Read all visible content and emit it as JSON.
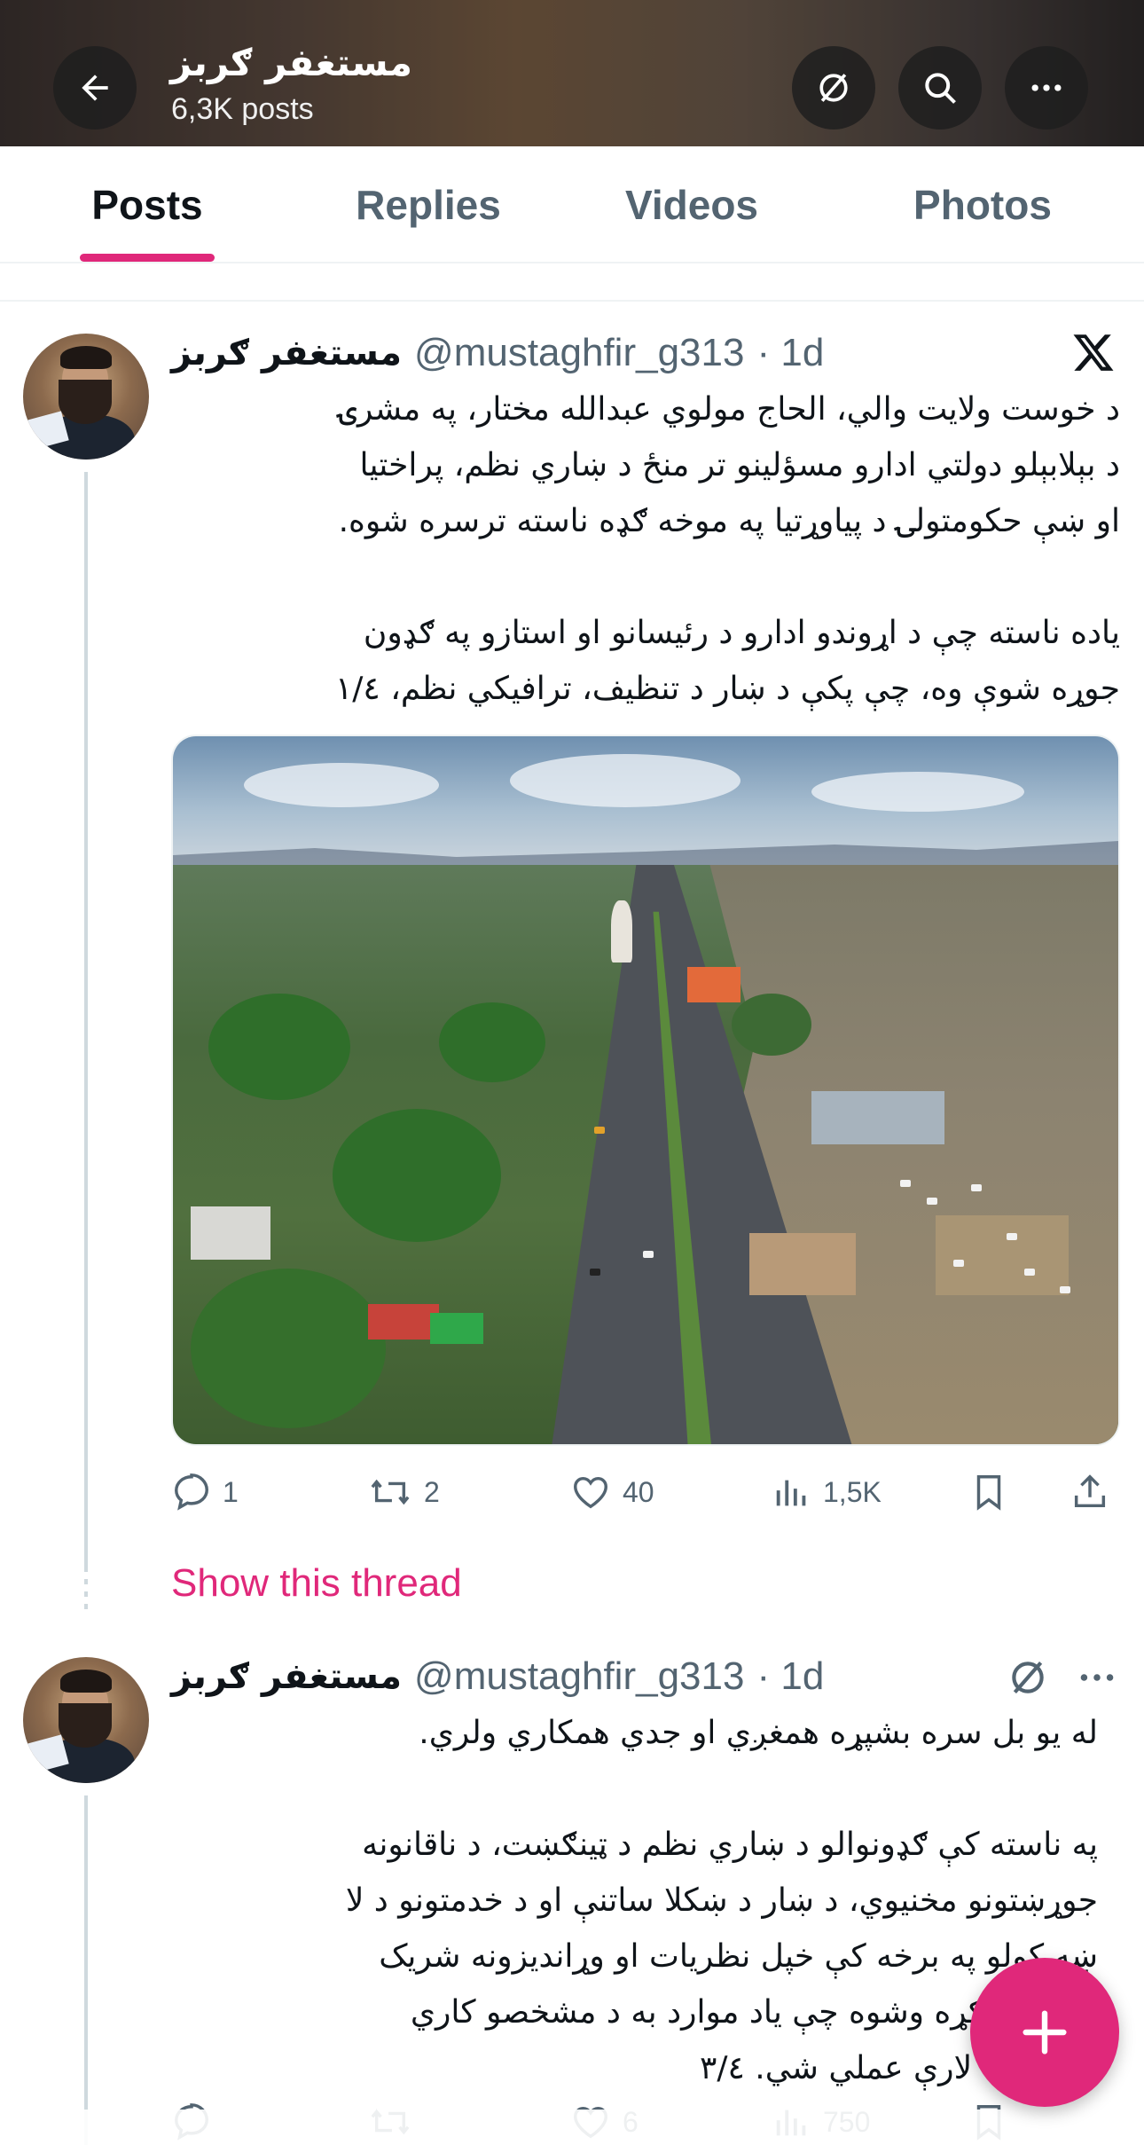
{
  "header": {
    "title": "مستغفر ګربز",
    "posts_count": "6,3K posts"
  },
  "tabs": [
    {
      "label": "Posts",
      "active": true
    },
    {
      "label": "Replies",
      "active": false
    },
    {
      "label": "Videos",
      "active": false
    },
    {
      "label": "Photos",
      "active": false
    }
  ],
  "tweets": [
    {
      "name": "مستغفر ګربز",
      "handle": "@mustaghfir_g313",
      "time": "· 1d",
      "text": "د خوست ولایت والي، الحاج مولوي عبدالله مختار، په مشرۍ\nد بېلابېلو دولتي ادارو مسؤلینو تر منځ د ښاري نظم، پراختیا\nاو ښې حکومتولۍ د پیاوړتیا په موخه ګډه ناسته ترسره شوه.\n\nیاده ناسته چې د اړوندو ادارو د رئیسانو او استازو په ګډون\nجوړه شوې وه، چې پکې د ښار د تنظیف، ترافیکي نظم، ۱/٤",
      "actions": {
        "replies": "1",
        "reposts": "2",
        "likes": "40",
        "views": "1,5K"
      }
    },
    {
      "name": "مستغفر ګربز",
      "handle": "@mustaghfir_g313",
      "time": "· 1d",
      "text": "له یو بل سره بشپړه همغږي او جدي همکاري ولري.\n\nپه ناسته کې ګډونوالو د ښاري نظم د ټینګښت، د ناقانونه\nجوړښتونو مخنیوي، د ښار د ښکلا ساتنې او د خدمتونو د لا\nښه کولو په برخه کې خپل نظریات او وړاندیزونه شریک\nکړل. پرېکړه وشوه چې یاد موارد به د مشخصو کاري\nپلانونو له لارې عملي شي. ۳/٤",
      "actions": {
        "replies": "",
        "reposts": "",
        "likes": "6",
        "views": "750"
      }
    }
  ],
  "show_thread": "Show this thread",
  "colors": {
    "accent": "#e0287a",
    "muted": "#536471",
    "text": "#0f1419"
  },
  "icons": [
    "back-arrow-icon",
    "hide-icon",
    "search-icon",
    "more-icon",
    "x-logo-icon",
    "reply-icon",
    "repost-icon",
    "like-icon",
    "views-icon",
    "bookmark-icon",
    "share-icon",
    "plus-icon"
  ]
}
